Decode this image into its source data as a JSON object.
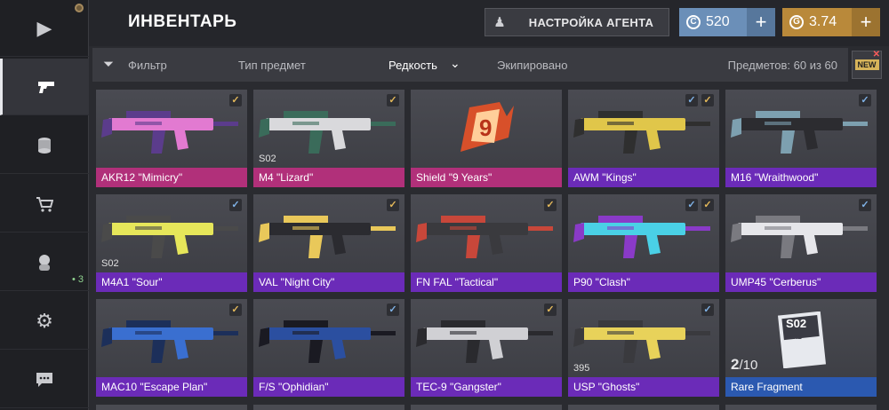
{
  "header": {
    "title": "ИНВЕНТАРЬ",
    "agent_button": "НАСТРОЙКА АГЕНТА",
    "silver_amount": "520",
    "gold_amount": "3.74",
    "plus": "+"
  },
  "sidebar": {
    "items": [
      {
        "icon": "play-icon"
      },
      {
        "icon": "pistol-icon",
        "active": true
      },
      {
        "icon": "coins-icon"
      },
      {
        "icon": "cart-icon"
      },
      {
        "icon": "agent-icon",
        "badge": "• 3"
      },
      {
        "icon": "gear-icon"
      },
      {
        "icon": "chat-icon"
      }
    ]
  },
  "filters": {
    "filter": "Фильтр",
    "type": "Тип предмет",
    "rarity": "Редкость",
    "equipped": "Экипировано",
    "count": "Предметов: 60 из 60",
    "new_badge": "NEW"
  },
  "colors": {
    "legendary": "#7b2fbe",
    "pink": "#b1307a",
    "purple": "#6b2bb8",
    "blue": "#2b59b0",
    "card_bg": "#45464c"
  },
  "items": [
    {
      "name": "AKR12 \"Mimicry\"",
      "rarity": "pink",
      "checks": [
        "gold"
      ],
      "art": [
        "#e27ad1",
        "#5b3c8c"
      ]
    },
    {
      "name": "M4 \"Lizard\"",
      "rarity": "pink",
      "checks": [
        "gold"
      ],
      "art": [
        "#d9d9dc",
        "#3a6b5a"
      ],
      "extra": "S02"
    },
    {
      "name": "Shield \"9 Years\"",
      "rarity": "pink",
      "checks": [],
      "art": [
        "#d8502a",
        "#ffcf9a"
      ],
      "shield": true
    },
    {
      "name": "AWM \"Kings\"",
      "rarity": "purple",
      "checks": [
        "blue",
        "gold"
      ],
      "art": [
        "#e0c64a",
        "#2f2f2f"
      ]
    },
    {
      "name": "M16 \"Wraithwood\"",
      "rarity": "purple",
      "checks": [
        "blue"
      ],
      "art": [
        "#2c2c30",
        "#7da0b0"
      ]
    },
    {
      "name": "M4A1 \"Sour\"",
      "rarity": "purple",
      "checks": [
        "blue"
      ],
      "art": [
        "#e6e65a",
        "#4a4a4a"
      ],
      "extra": "S02"
    },
    {
      "name": "VAL \"Night City\"",
      "rarity": "purple",
      "checks": [
        "gold"
      ],
      "art": [
        "#2b2b30",
        "#e9c85a"
      ]
    },
    {
      "name": "FN FAL \"Tactical\"",
      "rarity": "purple",
      "checks": [
        "gold"
      ],
      "art": [
        "#3a3a3e",
        "#c8473a"
      ]
    },
    {
      "name": "P90 \"Clash\"",
      "rarity": "purple",
      "checks": [
        "blue",
        "gold"
      ],
      "art": [
        "#4ad0e6",
        "#8a3ac8"
      ]
    },
    {
      "name": "UMP45 \"Cerberus\"",
      "rarity": "purple",
      "checks": [
        "blue"
      ],
      "art": [
        "#e6e6ea",
        "#7a7a80"
      ]
    },
    {
      "name": "MAC10 \"Escape Plan\"",
      "rarity": "purple",
      "checks": [
        "gold"
      ],
      "art": [
        "#3a6fd0",
        "#1c2f5a"
      ]
    },
    {
      "name": "F/S \"Ophidian\"",
      "rarity": "purple",
      "checks": [
        "blue"
      ],
      "art": [
        "#2b4fa0",
        "#1a1a22"
      ]
    },
    {
      "name": "TEC-9 \"Gangster\"",
      "rarity": "purple",
      "checks": [
        "gold"
      ],
      "art": [
        "#d0d0d4",
        "#2a2a2e"
      ]
    },
    {
      "name": "USP \"Ghosts\"",
      "rarity": "purple",
      "checks": [
        "blue"
      ],
      "art": [
        "#e8d25a",
        "#3a3a3e"
      ],
      "extra": "395"
    },
    {
      "name": "Rare Fragment",
      "rarity": "blue",
      "checks": [],
      "fragment": true,
      "frac_num": "2",
      "frac_den": "10",
      "frag_code": "S02",
      "frag_label": "RARE"
    }
  ]
}
